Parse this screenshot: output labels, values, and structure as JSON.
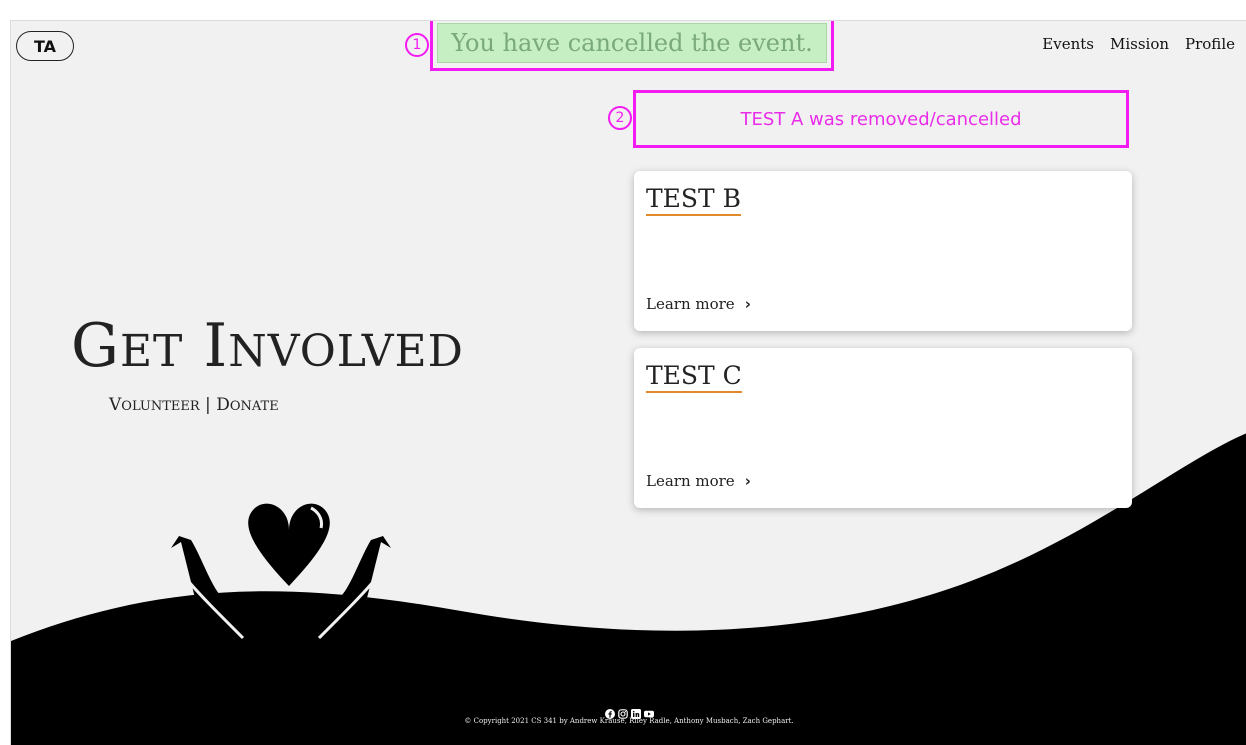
{
  "logo": {
    "text": "TA"
  },
  "nav": {
    "items": [
      "Events",
      "Mission",
      "Profile"
    ]
  },
  "flash": {
    "message": "You have cancelled the event.",
    "marker": "1"
  },
  "removed_notice": {
    "message": "TEST A was removed/cancelled",
    "marker": "2"
  },
  "cards": [
    {
      "title": "TEST B",
      "link": "Learn more"
    },
    {
      "title": "TEST C",
      "link": "Learn more"
    }
  ],
  "hero": {
    "title_first_letter_1": "G",
    "title_rest_1": "ET",
    "title_first_letter_2": "I",
    "title_rest_2": "NVOLVED",
    "sub_v": "V",
    "sub_v_rest": "OLUNTEER",
    "sub_sep": "|",
    "sub_d": "D",
    "sub_d_rest": "ONATE"
  },
  "footer": {
    "copyright": "© Copyright 2021 CS 341 by Andrew Krause, Riley Radle, Anthony Musbach, Zach Gephart.",
    "social_icons": [
      "facebook-icon",
      "instagram-icon",
      "linkedin-icon",
      "youtube-icon"
    ]
  },
  "colors": {
    "annotation": "#f21cf2",
    "flash_bg": "#c6efc4",
    "accent_underline": "#e08a2c",
    "page_bg": "#f1f1f1"
  }
}
